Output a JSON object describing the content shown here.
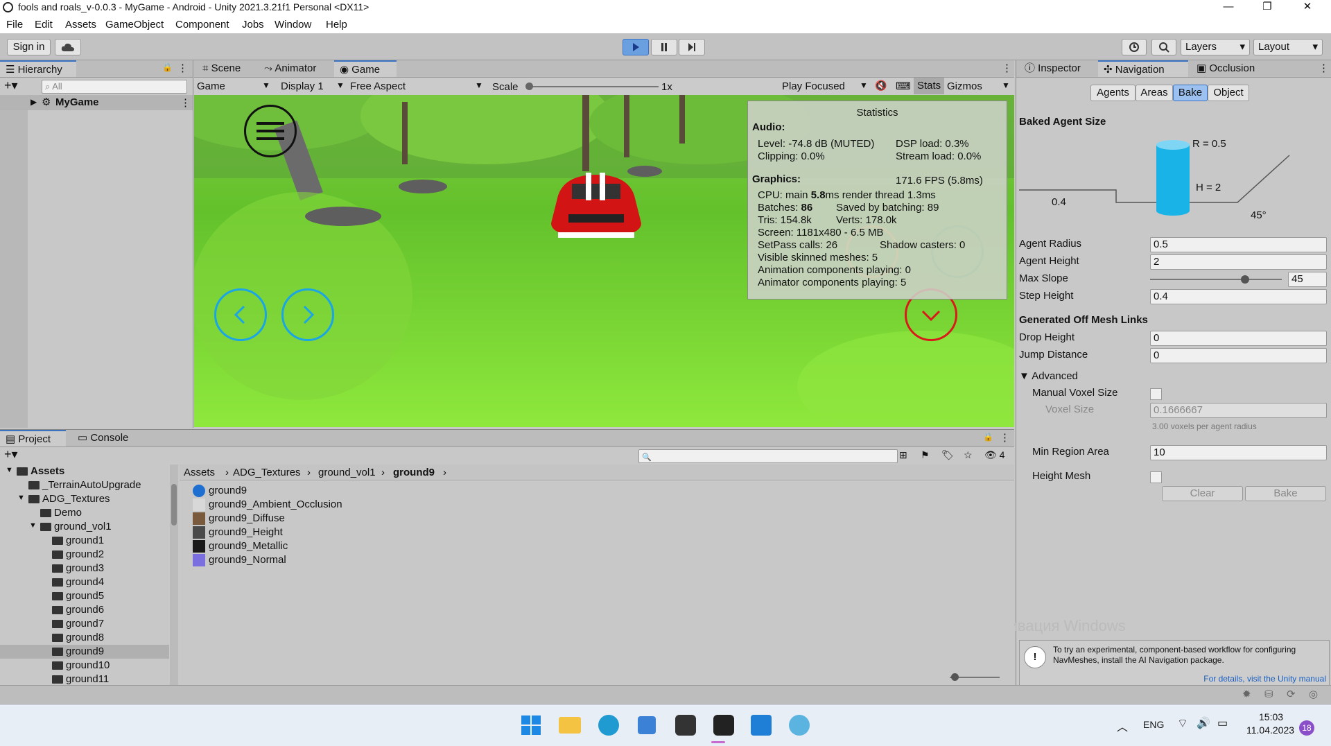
{
  "window": {
    "title": "fools and roals_v-0.0.3 - MyGame - Android - Unity 2021.3.21f1 Personal <DX11>",
    "controls": [
      "—",
      "❐",
      "✕"
    ]
  },
  "menu": [
    "File",
    "Edit",
    "Assets",
    "GameObject",
    "Component",
    "Jobs",
    "Window",
    "Help"
  ],
  "toolbar": {
    "sign_in": "Sign in",
    "layers": "Layers",
    "layout": "Layout"
  },
  "hierarchy": {
    "tab": "Hierarchy",
    "search_placeholder": "All",
    "root": "MyGame"
  },
  "game_panel": {
    "tabs": [
      "Scene",
      "Animator",
      "Game"
    ],
    "game_dropdown": "Game",
    "display": "Display 1",
    "aspect": "Free Aspect",
    "scale_label": "Scale",
    "scale_value": "1x",
    "play_focused": "Play Focused",
    "stats": "Stats",
    "gizmos": "Gizmos"
  },
  "statistics": {
    "title": "Statistics",
    "audio_header": "Audio:",
    "level": "Level: -74.8 dB (MUTED)",
    "dsp": "DSP load: 0.3%",
    "clipping": "Clipping: 0.0%",
    "stream": "Stream load: 0.0%",
    "graphics_header": "Graphics:",
    "fps": "171.6 FPS (5.8ms)",
    "cpu_prefix": "CPU: main ",
    "cpu_main": "5.8",
    "cpu_suffix": "ms  render thread 1.3ms",
    "batches_prefix": "Batches: ",
    "batches": "86",
    "saved": "Saved by batching: 89",
    "tris": "Tris: 154.8k",
    "verts": "Verts: 178.0k",
    "screen": "Screen: 1181x480 - 6.5 MB",
    "setpass": "SetPass calls: 26",
    "shadow": "Shadow casters: 0",
    "skinned": "Visible skinned meshes: 5",
    "anim": "Animation components playing: 0",
    "animator": "Animator components playing: 5"
  },
  "inspector": {
    "tabs": [
      "Inspector",
      "Navigation",
      "Occlusion"
    ],
    "subtabs": [
      "Agents",
      "Areas",
      "Bake",
      "Object"
    ],
    "baked_agent_size": "Baked Agent Size",
    "r_label": "R = 0.5",
    "h_label": "H = 2",
    "step_label": "0.4",
    "slope_label": "45°",
    "agent_radius_label": "Agent Radius",
    "agent_radius": "0.5",
    "agent_height_label": "Agent Height",
    "agent_height": "2",
    "max_slope_label": "Max Slope",
    "max_slope": "45",
    "max_slope_fraction": 0.72,
    "step_height_label": "Step Height",
    "step_height": "0.4",
    "offmesh_header": "Generated Off Mesh Links",
    "drop_height_label": "Drop Height",
    "drop_height": "0",
    "jump_distance_label": "Jump Distance",
    "jump_distance": "0",
    "advanced": "Advanced",
    "manual_voxel_label": "Manual Voxel Size",
    "voxel_size_label": "Voxel Size",
    "voxel_size": "0.1666667",
    "voxel_hint": "3.00 voxels per agent radius",
    "min_region_label": "Min Region Area",
    "min_region": "10",
    "height_mesh_label": "Height Mesh",
    "clear": "Clear",
    "bake": "Bake",
    "info_text": "To try an experimental, component-based workflow for configuring NavMeshes, install the AI Navigation package.",
    "info_link": "For details, visit the Unity manual",
    "watermark": "Активация Windows"
  },
  "project": {
    "tabs": [
      "Project",
      "Console"
    ],
    "hidden_count": "4",
    "breadcrumb": [
      "Assets",
      "ADG_Textures",
      "ground_vol1",
      "ground9"
    ],
    "tree": [
      {
        "label": "Assets",
        "indent": 0,
        "bold": true,
        "expanded": true
      },
      {
        "label": "_TerrainAutoUpgrade",
        "indent": 1
      },
      {
        "label": "ADG_Textures",
        "indent": 1,
        "expanded": true
      },
      {
        "label": "Demo",
        "indent": 2
      },
      {
        "label": "ground_vol1",
        "indent": 2,
        "expanded": true
      },
      {
        "label": "ground1",
        "indent": 3
      },
      {
        "label": "ground2",
        "indent": 3
      },
      {
        "label": "ground3",
        "indent": 3
      },
      {
        "label": "ground4",
        "indent": 3
      },
      {
        "label": "ground5",
        "indent": 3
      },
      {
        "label": "ground6",
        "indent": 3
      },
      {
        "label": "ground7",
        "indent": 3
      },
      {
        "label": "ground8",
        "indent": 3
      },
      {
        "label": "ground9",
        "indent": 3,
        "selected": true
      },
      {
        "label": "ground10",
        "indent": 3
      },
      {
        "label": "ground11",
        "indent": 3
      }
    ],
    "files": [
      {
        "label": "ground9",
        "color": "#1e6fd0",
        "round": true
      },
      {
        "label": "ground9_Ambient_Occlusion",
        "color": "#d8d8d8"
      },
      {
        "label": "ground9_Diffuse",
        "color": "#7a5a3c"
      },
      {
        "label": "ground9_Height",
        "color": "#4a4a4a"
      },
      {
        "label": "ground9_Metallic",
        "color": "#1a1a1a"
      },
      {
        "label": "ground9_Normal",
        "color": "#7b6fe0"
      }
    ]
  },
  "taskbar": {
    "lang": "ENG",
    "time": "15:03",
    "date": "11.04.2023",
    "badge": "18"
  }
}
